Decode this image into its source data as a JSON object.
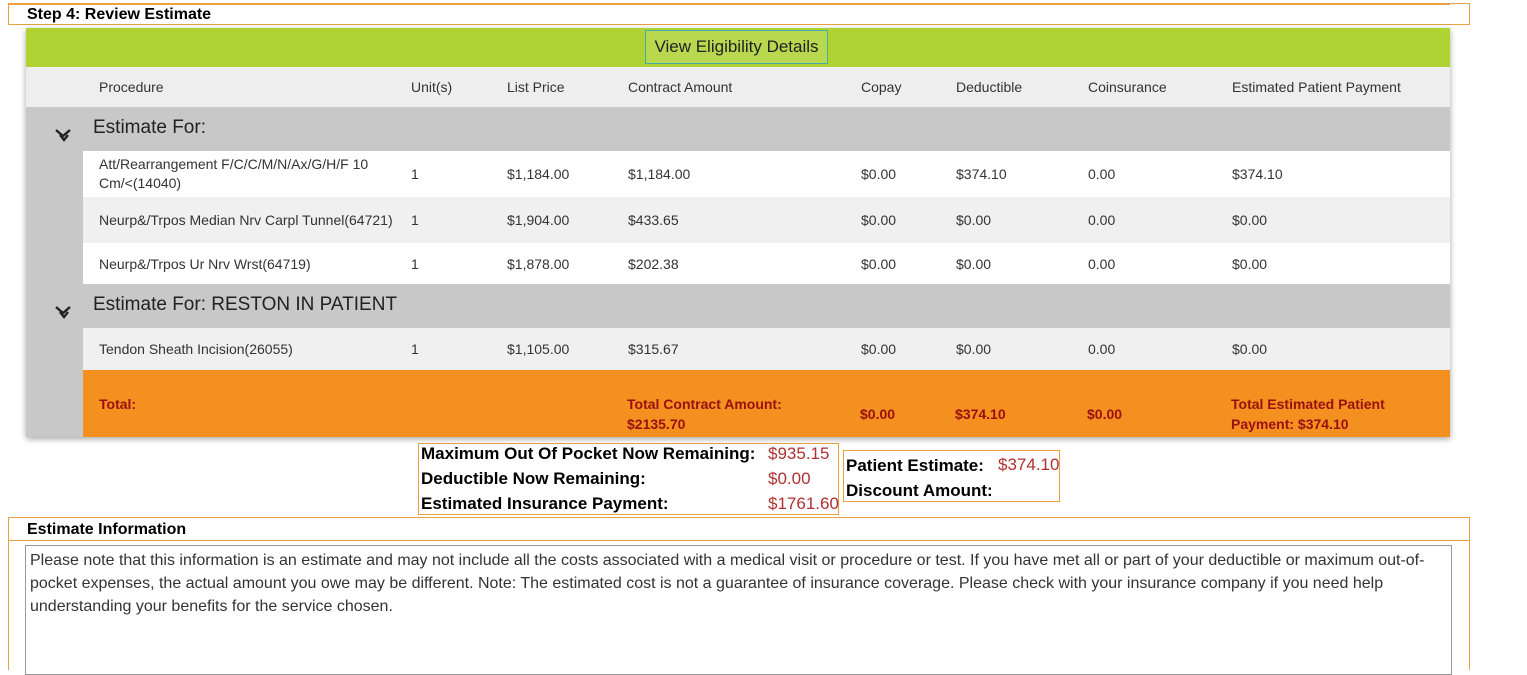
{
  "step": {
    "title": "Step 4: Review Estimate"
  },
  "eligibility_button": "View Eligibility Details",
  "columns": [
    "Procedure",
    "Unit(s)",
    "List Price",
    "Contract Amount",
    "Copay",
    "Deductible",
    "Coinsurance",
    "Estimated Patient Payment"
  ],
  "groups": [
    {
      "title": "Estimate For:",
      "rows": [
        {
          "procedure": "Att/Rearrangement F/C/C/M/N/Ax/G/H/F 10 Cm/<(14040)",
          "units": "1",
          "list_price": "$1,184.00",
          "contract": "$1,184.00",
          "copay": "$0.00",
          "deductible": "$374.10",
          "coinsurance": "0.00",
          "patient_payment": "$374.10"
        },
        {
          "procedure": "Neurp&/Trpos Median Nrv Carpl Tunnel(64721)",
          "units": "1",
          "list_price": "$1,904.00",
          "contract": "$433.65",
          "copay": "$0.00",
          "deductible": "$0.00",
          "coinsurance": "0.00",
          "patient_payment": "$0.00"
        },
        {
          "procedure": "Neurp&/Trpos Ur Nrv Wrst(64719)",
          "units": "1",
          "list_price": "$1,878.00",
          "contract": "$202.38",
          "copay": "$0.00",
          "deductible": "$0.00",
          "coinsurance": "0.00",
          "patient_payment": "$0.00"
        }
      ]
    },
    {
      "title": "Estimate For: RESTON IN PATIENT",
      "rows": [
        {
          "procedure": "Tendon Sheath Incision(26055)",
          "units": "1",
          "list_price": "$1,105.00",
          "contract": "$315.67",
          "copay": "$0.00",
          "deductible": "$0.00",
          "coinsurance": "0.00",
          "patient_payment": "$0.00"
        }
      ]
    }
  ],
  "totals": {
    "label": "Total:",
    "contract": "Total Contract Amount: $2135.70",
    "copay": "$0.00",
    "deductible": "$374.10",
    "coinsurance": "$0.00",
    "patient_payment": "Total Estimated Patient Payment: $374.10"
  },
  "summary": {
    "max_oop_label": "Maximum Out Of Pocket Now Remaining:",
    "max_oop_value": "$935.15",
    "deductible_label": "Deductible Now Remaining:",
    "deductible_value": "$0.00",
    "insurance_label": "Estimated Insurance Payment:",
    "insurance_value": "$1761.60",
    "patient_label": "Patient Estimate:",
    "patient_value": "$374.10",
    "discount_label": "Discount Amount:"
  },
  "info": {
    "title": "Estimate Information",
    "text": "Please note that this information is an estimate and may not include all the costs associated with a medical visit or procedure or test. If you have met all or part of your deductible or maximum out-of-pocket expenses, the actual amount you owe may be different. Note: The estimated cost is not a guarantee of insurance coverage. Please check with your insurance company if you need help understanding your benefits for the service chosen."
  },
  "colors": {
    "accent_green": "#b0d334",
    "total_orange": "#f39020",
    "value_red": "#b03030"
  }
}
